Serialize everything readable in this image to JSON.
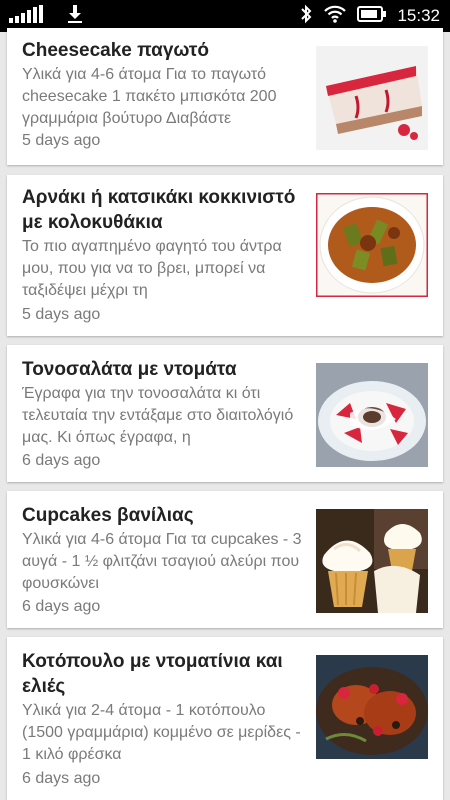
{
  "status_bar": {
    "time": "15:32",
    "icons": [
      "signal-bars-icon",
      "download-icon",
      "bluetooth-icon",
      "wifi-icon",
      "battery-icon"
    ]
  },
  "recipes": [
    {
      "title": "Cheesecake παγωτό",
      "description": "Υλικά για 4-6 άτομα Για το παγωτό cheesecake 1 πακέτο μπισκότα 200 γραμμάρια βούτυρο Διαβάστε",
      "age": "5 days ago",
      "image": "cheesecake-image"
    },
    {
      "title": "Αρνάκι ή κατσικάκι κοκκινιστό με κολοκυθάκια",
      "description": "Το πιο αγαπημένο φαγητό του άντρα μου, που για να το βρει, μπορεί να ταξιδέψει μέχρι τη",
      "age": "5 days ago",
      "image": "lamb-stew-image"
    },
    {
      "title": "Τονοσαλάτα με ντομάτα",
      "description": "Έγραφα για την τονοσαλάτα κι ότι τελευταία την εντάξαμε στο διαιτολόγιό μας. Κι όπως έγραφα, η",
      "age": "6 days ago",
      "image": "tuna-salad-image"
    },
    {
      "title": "Cupcakes βανίλιας",
      "description": "Υλικά για 4-6 άτομα Για τα cupcakes - 3 αυγά - 1 ½ φλιτζάνι τσαγιού αλεύρι που φουσκώνει",
      "age": "6 days ago",
      "image": "cupcakes-image"
    },
    {
      "title": "Κοτόπουλο με ντοματίνια και ελιές",
      "description": "Υλικά για 2-4 άτομα - 1 κοτόπουλο (1500 γραμμάρια) κομμένο σε μερίδες - 1 κιλό φρέσκα",
      "age": "6 days ago",
      "image": "chicken-dish-image"
    }
  ]
}
